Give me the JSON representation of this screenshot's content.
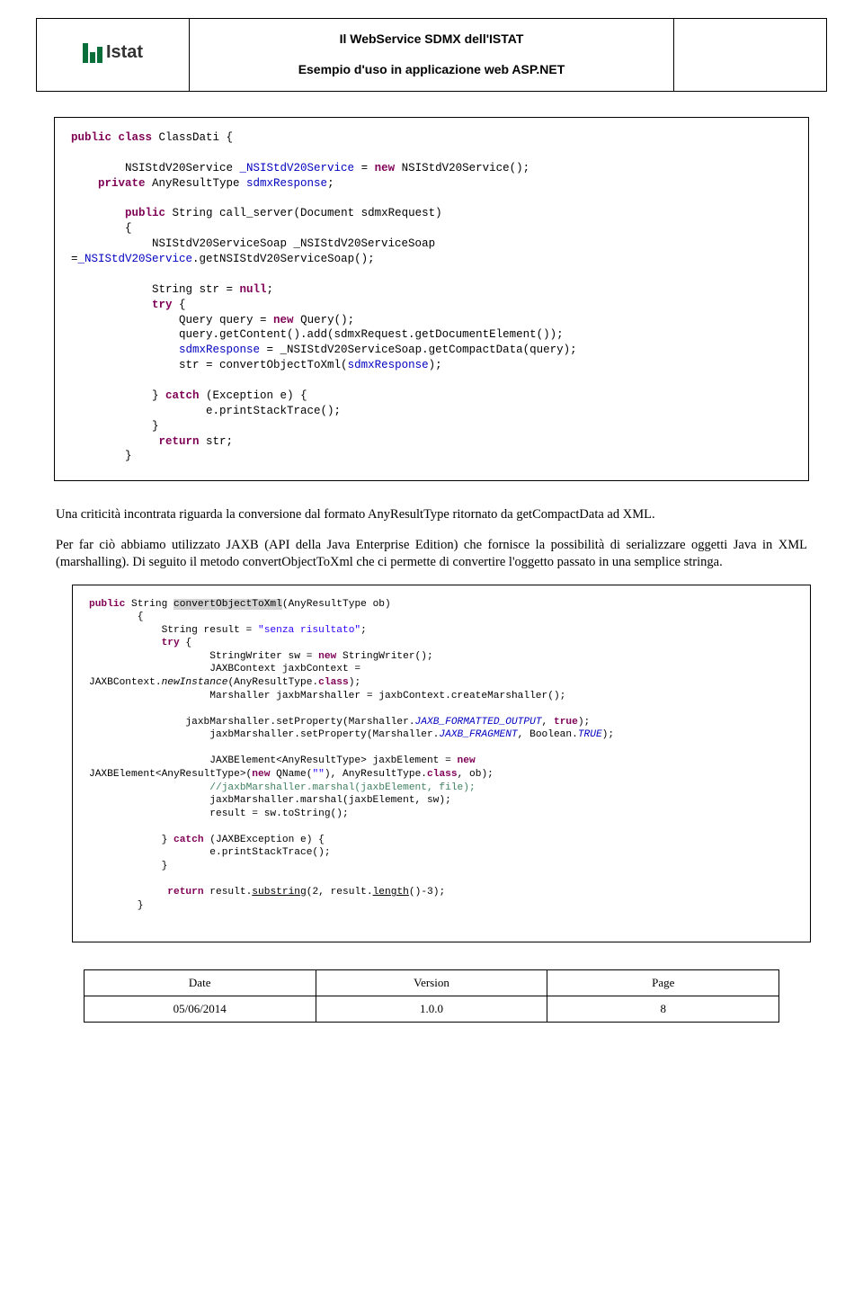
{
  "header": {
    "logo_text": "Istat",
    "title": "Il WebService SDMX dell'ISTAT",
    "subtitle": "Esempio d'uso in applicazione web ASP.NET"
  },
  "code1": {
    "l1a": "public",
    "l1b": " class",
    "l1c": " ClassDati {",
    "l2a": "        NSIStdV20Service ",
    "l2b": "_NSIStdV20Service",
    "l2c": " = ",
    "l2d": "new",
    "l2e": " NSIStdV20Service();",
    "l3a": "    private",
    "l3b": " AnyResultType ",
    "l3c": "sdmxResponse",
    "l3d": ";",
    "l4a": "        public",
    "l4b": " String call_server(Document sdmxRequest)",
    "l5": "        {",
    "l6a": "            NSIStdV20ServiceSoap _NSIStdV20ServiceSoap",
    "l7a": "=",
    "l7b": "_NSIStdV20Service",
    "l7c": ".getNSIStdV20ServiceSoap();",
    "l8a": "            String str = ",
    "l8b": "null",
    "l8c": ";",
    "l9a": "            try",
    "l9b": " {",
    "l10a": "                Query query = ",
    "l10b": "new",
    "l10c": " Query();",
    "l11a": "                query.getContent().add(sdmxRequest.getDocumentElement());",
    "l12a": "                ",
    "l12b": "sdmxResponse",
    "l12c": " = _NSIStdV20ServiceSoap.getCompactData(query);",
    "l13a": "                str = convertObjectToXml(",
    "l13b": "sdmxResponse",
    "l13c": ");",
    "l14a": "            } ",
    "l14b": "catch",
    "l14c": " (Exception e) {",
    "l15": "                    e.printStackTrace();",
    "l16": "            }",
    "l17a": "             ",
    "l17b": "return",
    "l17c": " str;",
    "l18": "        }"
  },
  "para1": "Una criticità incontrata riguarda la conversione dal formato AnyResultType ritornato da getCompactData ad XML.",
  "para2": "Per far ciò abbiamo utilizzato JAXB (API della Java Enterprise Edition) che fornisce la possibilità di serializzare oggetti Java in XML (marshalling). Di seguito il metodo convertObjectToXml che ci permette di convertire l'oggetto passato in una semplice stringa.",
  "code2": {
    "l1a": "public",
    "l1b": " String ",
    "l1c": "convertObjectToXml",
    "l1d": "(AnyResultType ob)",
    "l2": "        {",
    "l3a": "            String result = ",
    "l3b": "\"senza risultato\"",
    "l3c": ";",
    "l4a": "            try",
    "l4b": " {",
    "l5a": "                    StringWriter sw = ",
    "l5b": "new",
    "l5c": " StringWriter();",
    "l6": "                    JAXBContext jaxbContext =",
    "l7a": "JAXBContext.",
    "l7b": "newInstance",
    "l7c": "(AnyResultType.",
    "l7d": "class",
    "l7e": ");",
    "l8": "                    Marshaller jaxbMarshaller = jaxbContext.createMarshaller();",
    "l9a": "                jaxbMarshaller.setProperty(Marshaller.",
    "l9b": "JAXB_FORMATTED_OUTPUT",
    "l9c": ", ",
    "l9d": "true",
    "l9e": ");",
    "l10a": "                    jaxbMarshaller.setProperty(Marshaller.",
    "l10b": "JAXB_FRAGMENT",
    "l10c": ", Boolean.",
    "l10d": "TRUE",
    "l10e": ");",
    "l11a": "                    JAXBElement<AnyResultType> jaxbElement = ",
    "l11b": "new",
    "l12a": "JAXBElement<AnyResultType>(",
    "l12b": "new",
    "l12c": " QName(",
    "l12d": "\"\"",
    "l12e": "), AnyResultType.",
    "l12f": "class",
    "l12g": ", ob);",
    "l13a": "                    ",
    "l13b": "//jaxbMarshaller.marshal(jaxbElement, file);",
    "l14": "                    jaxbMarshaller.marshal(jaxbElement, sw);",
    "l15": "                    result = sw.toString();",
    "l16a": "            } ",
    "l16b": "catch",
    "l16c": " (JAXBException e) {",
    "l17": "                    e.printStackTrace();",
    "l18": "            }",
    "l19a": "             ",
    "l19b": "return",
    "l19c": " result.",
    "l19d": "substring",
    "l19e": "(2, result.",
    "l19f": "length",
    "l19g": "()-3);",
    "l20": "        }"
  },
  "footer": {
    "h1": "Date",
    "h2": "Version",
    "h3": "Page",
    "v1": "05/06/2014",
    "v2": "1.0.0",
    "v3": "8"
  }
}
